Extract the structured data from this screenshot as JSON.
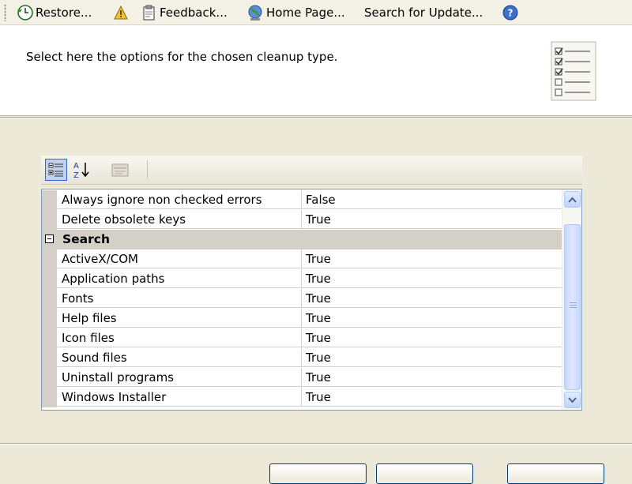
{
  "toolbar": {
    "items": [
      {
        "label": "Restore...",
        "icon": "restore-clock-icon"
      },
      {
        "label": "",
        "icon": "wizard-icon"
      },
      {
        "label": "Feedback...",
        "icon": "feedback-clipboard-icon"
      },
      {
        "label": "Home Page...",
        "icon": "globe-icon"
      },
      {
        "label": "Search for Update...",
        "icon": ""
      },
      {
        "label": "",
        "icon": "help-icon"
      }
    ]
  },
  "header": {
    "description": "Select here the options for the chosen cleanup type.",
    "icon": "checklist-icon"
  },
  "property_grid": {
    "toolbar_buttons": [
      "categorized-view-icon",
      "alphabetical-sort-icon",
      "property-pages-icon"
    ],
    "rows": [
      {
        "type": "prop",
        "name": "Always ignore non checked errors",
        "value": "False"
      },
      {
        "type": "prop",
        "name": "Delete obsolete keys",
        "value": "True"
      },
      {
        "type": "category",
        "name": "Search"
      },
      {
        "type": "prop",
        "name": "ActiveX/COM",
        "value": "True"
      },
      {
        "type": "prop",
        "name": "Application paths",
        "value": "True"
      },
      {
        "type": "prop",
        "name": "Fonts",
        "value": "True"
      },
      {
        "type": "prop",
        "name": "Help files",
        "value": "True"
      },
      {
        "type": "prop",
        "name": "Icon files",
        "value": "True"
      },
      {
        "type": "prop",
        "name": "Sound files",
        "value": "True"
      },
      {
        "type": "prop",
        "name": "Uninstall programs",
        "value": "True"
      },
      {
        "type": "prop",
        "name": "Windows Installer",
        "value": "True"
      }
    ]
  },
  "colors": {
    "dialog_bg": "#ece9d8",
    "selection_border": "#3169c6",
    "scrollbar_blue": "#c2d3fc"
  }
}
